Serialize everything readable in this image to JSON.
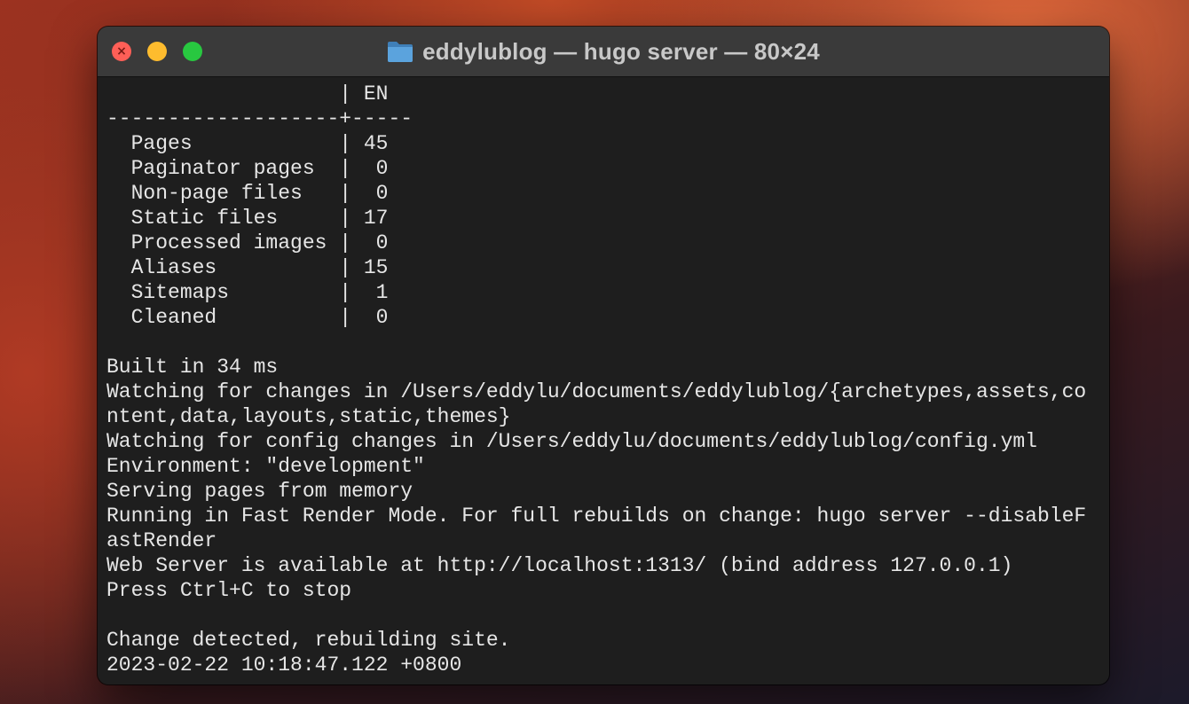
{
  "window": {
    "title": "eddylublog — hugo server — 80×24",
    "folder_icon": "folder-icon"
  },
  "traffic_lights": {
    "close_color": "#ff5f57",
    "minimize_color": "#febc2e",
    "zoom_color": "#28c840",
    "close_glyph": "×"
  },
  "terminal": {
    "lines": [
      "                   | EN",
      "-------------------+-----",
      "  Pages            | 45",
      "  Paginator pages  |  0",
      "  Non-page files   |  0",
      "  Static files     | 17",
      "  Processed images |  0",
      "  Aliases          | 15",
      "  Sitemaps         |  1",
      "  Cleaned          |  0",
      "",
      "Built in 34 ms",
      "Watching for changes in /Users/eddylu/documents/eddylublog/{archetypes,assets,co",
      "ntent,data,layouts,static,themes}",
      "Watching for config changes in /Users/eddylu/documents/eddylublog/config.yml",
      "Environment: \"development\"",
      "Serving pages from memory",
      "Running in Fast Render Mode. For full rebuilds on change: hugo server --disableF",
      "astRender",
      "Web Server is available at http://localhost:1313/ (bind address 127.0.0.1)",
      "Press Ctrl+C to stop",
      "",
      "Change detected, rebuilding site.",
      "2023-02-22 10:18:47.122 +0800"
    ]
  }
}
